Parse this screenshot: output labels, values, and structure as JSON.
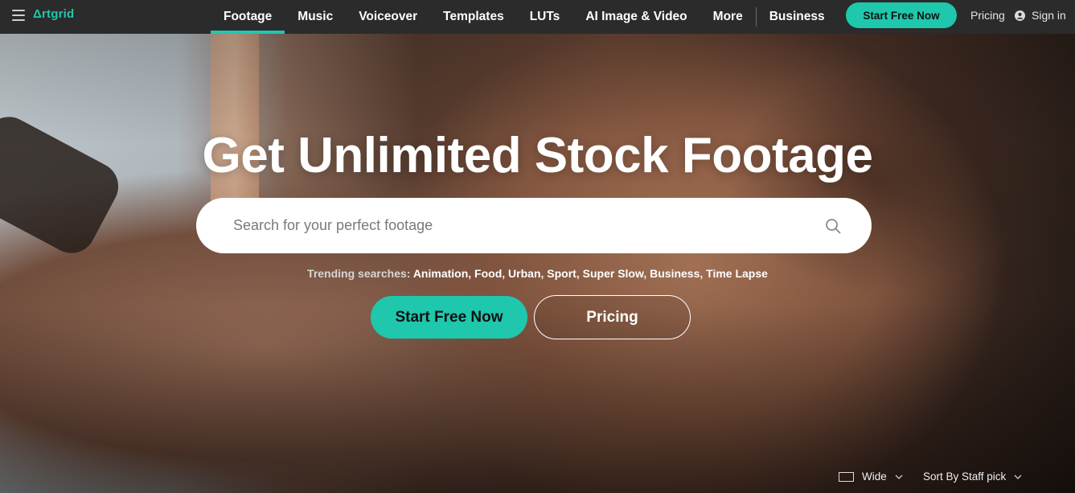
{
  "nav": {
    "logo": "Δrtgrid",
    "links": [
      {
        "label": "Footage",
        "active": true
      },
      {
        "label": "Music",
        "active": false
      },
      {
        "label": "Voiceover",
        "active": false
      },
      {
        "label": "Templates",
        "active": false
      },
      {
        "label": "LUTs",
        "active": false
      },
      {
        "label": "AI Image & Video",
        "active": false
      },
      {
        "label": "More",
        "active": false
      }
    ],
    "business": "Business",
    "start_free": "Start Free Now",
    "pricing": "Pricing",
    "sign_in": "Sign in"
  },
  "hero": {
    "title": "Get Unlimited Stock Footage",
    "search_placeholder": "Search for your perfect footage",
    "trending_label": "Trending searches:",
    "trending": [
      "Animation",
      "Food",
      "Urban",
      "Sport",
      "Super Slow",
      "Business",
      "Time Lapse"
    ],
    "cta_start": "Start Free Now",
    "cta_pricing": "Pricing"
  },
  "controls": {
    "view": "Wide",
    "sort": "Sort By Staff pick"
  },
  "colors": {
    "accent": "#1fc7ad",
    "nav_bg": "#2b2b2b"
  }
}
